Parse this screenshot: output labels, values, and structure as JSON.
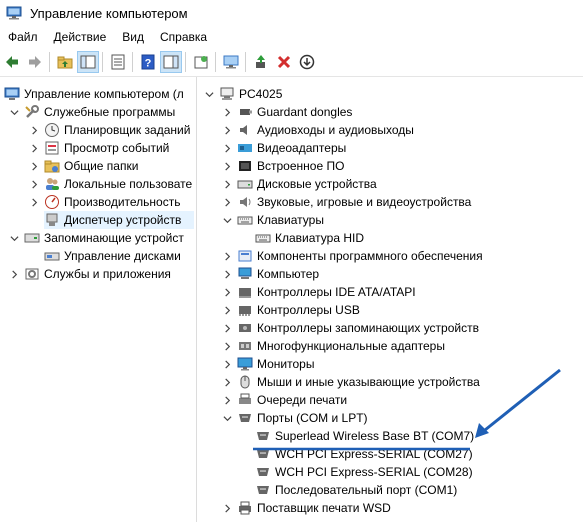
{
  "window": {
    "title": "Управление компьютером"
  },
  "menu": [
    "Файл",
    "Действие",
    "Вид",
    "Справка"
  ],
  "toolbar_icons": [
    "back-icon",
    "forward-icon",
    "up-folder-icon",
    "show-hide-tree-icon",
    "properties-icon",
    "help-icon",
    "action-pane-icon",
    "export-list-icon",
    "monitor-icon",
    "update-driver-icon",
    "uninstall-icon",
    "disable-icon"
  ],
  "left_tree": {
    "root": "Управление компьютером (л",
    "system_tools": "Служебные программы",
    "task_scheduler": "Планировщик заданий",
    "event_viewer": "Просмотр событий",
    "shared_folders": "Общие папки",
    "local_users": "Локальные пользовате",
    "performance": "Производительность",
    "device_manager": "Диспетчер устройств",
    "storage": "Запоминающие устройст",
    "disk_management": "Управление дисками",
    "services": "Службы и приложения"
  },
  "device_tree": {
    "computer": "PC4025",
    "categories": [
      {
        "label": "Guardant dongles",
        "icon": "dongle-icon",
        "expanded": false
      },
      {
        "label": "Аудиовходы и аудиовыходы",
        "icon": "speaker-icon",
        "expanded": false
      },
      {
        "label": "Видеоадаптеры",
        "icon": "display-adapter-icon",
        "expanded": false
      },
      {
        "label": "Встроенное ПО",
        "icon": "firmware-icon",
        "expanded": false
      },
      {
        "label": "Дисковые устройства",
        "icon": "disk-drive-icon",
        "expanded": false
      },
      {
        "label": "Звуковые, игровые и видеоустройства",
        "icon": "sound-icon",
        "expanded": false
      },
      {
        "label": "Клавиатуры",
        "icon": "keyboard-icon",
        "expanded": true
      },
      {
        "label": "Компоненты программного обеспечения",
        "icon": "software-component-icon",
        "expanded": false
      },
      {
        "label": "Компьютер",
        "icon": "computer-icon",
        "expanded": false
      },
      {
        "label": "Контроллеры IDE ATA/ATAPI",
        "icon": "ide-controller-icon",
        "expanded": false
      },
      {
        "label": "Контроллеры USB",
        "icon": "usb-controller-icon",
        "expanded": false
      },
      {
        "label": "Контроллеры запоминающих устройств",
        "icon": "storage-controller-icon",
        "expanded": false
      },
      {
        "label": "Многофункциональные адаптеры",
        "icon": "multifunction-adapter-icon",
        "expanded": false
      },
      {
        "label": "Мониторы",
        "icon": "monitor-icon",
        "expanded": false
      },
      {
        "label": "Мыши и иные указывающие устройства",
        "icon": "mouse-icon",
        "expanded": false
      },
      {
        "label": "Очереди печати",
        "icon": "print-queue-icon",
        "expanded": false
      },
      {
        "label": "Порты (COM и LPT)",
        "icon": "port-icon",
        "expanded": true
      },
      {
        "label": "Поставщик печати WSD",
        "icon": "printer-icon",
        "expanded": false
      }
    ],
    "keyboard_child": "Клавиатура HID",
    "port_children": [
      "Superlead Wireless Base BT (COM7)",
      "WCH PCI Express-SERIAL (COM27)",
      "WCH PCI Express-SERIAL (COM28)",
      "Последовательный порт (COM1)"
    ]
  },
  "colors": {
    "accent": "#1f5fb5",
    "selection": "#e5f3ff",
    "annotation": "#1f5fb5"
  }
}
